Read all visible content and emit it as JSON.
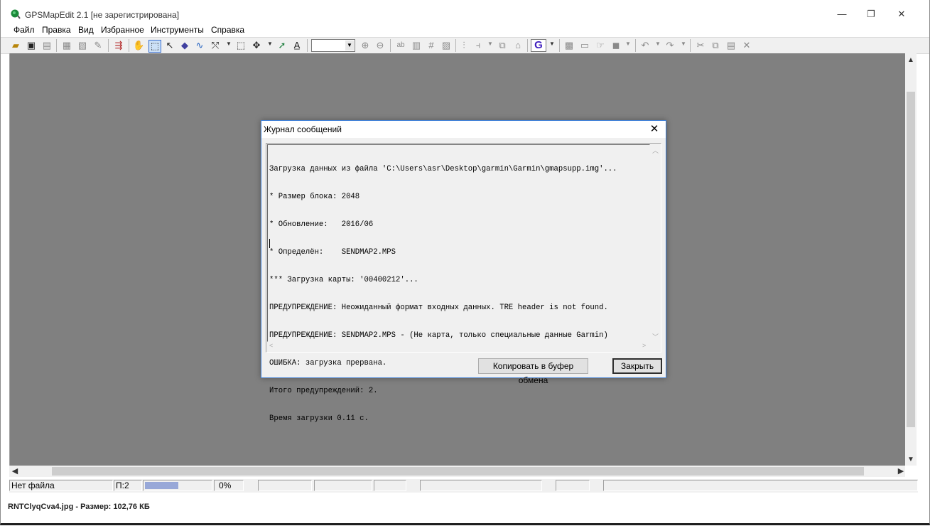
{
  "window": {
    "title": "GPSMapEdit 2.1 [не зарегистрирована]",
    "minimize": "—",
    "restore": "❐",
    "close": "✕"
  },
  "menu": [
    "Файл",
    "Правка",
    "Вид",
    "Избранное",
    "Инструменты",
    "Справка"
  ],
  "toolbar": {
    "zoom_value": "",
    "icons": [
      "open-icon",
      "save-icon",
      "save-as-icon",
      "import-icon",
      "export-icon",
      "map-properties-icon",
      "track-icon",
      "hand-icon",
      "zoom-rect-icon",
      "select-icon",
      "polygon-icon",
      "polyline-icon",
      "node-icon",
      "select-rect-icon",
      "move-icon",
      "route-icon",
      "label-icon",
      "zoom-in-icon",
      "zoom-out-icon",
      "labels-icon",
      "ruler-icon",
      "grid-icon",
      "layers-icon",
      "split-icon",
      "merge-icon",
      "copy-objects-icon",
      "building-icon",
      "garmin-icon",
      "map-icon",
      "page-icon",
      "hand-pointer-icon",
      "fill-icon",
      "undo-icon",
      "redo-icon",
      "cut-icon",
      "copy-icon",
      "paste-icon",
      "delete-icon"
    ],
    "garmin_letter": "G"
  },
  "dialog": {
    "title": "Журнал сообщений",
    "close": "✕",
    "log_lines": [
      "Загрузка данных из файла 'C:\\Users\\asr\\Desktop\\garmin\\Garmin\\gmapsupp.img'...",
      "* Размер блока: 2048",
      "* Обновление:   2016/06",
      "* Определён:    SENDMAP2.MPS",
      "*** Загрузка карты: '00400212'...",
      "ПРЕДУПРЕЖДЕНИЕ: Неожиданный формат входных данных. TRE header is not found.",
      "ПРЕДУПРЕЖДЕНИЕ: SENDMAP2.MPS - (Не карта, только специальные данные Garmin)",
      "ОШИБКА: загрузка прервана.",
      "Итого предупреждений: 2.",
      "Время загрузки 0.11 с."
    ],
    "copy_button": "Копировать в буфер обмена",
    "close_button": "Закрыть"
  },
  "status": {
    "file": "Нет файла",
    "layer": "П:2",
    "progress_percent": 35,
    "percent_text": "0%"
  },
  "caption": "RNTClyqCva4.jpg - Размер: 102,76 КБ"
}
